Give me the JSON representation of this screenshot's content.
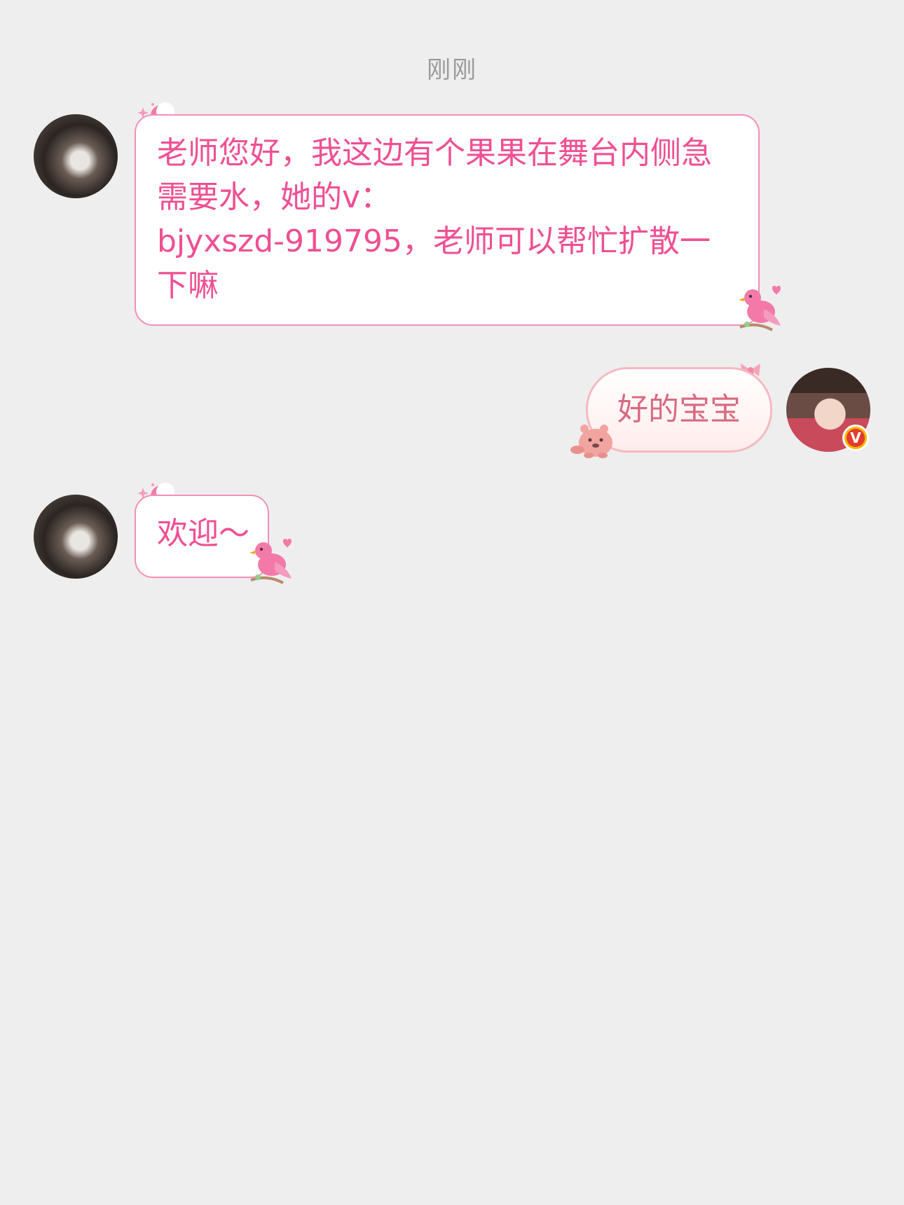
{
  "timestamp": "刚刚",
  "messages": [
    {
      "sender": "teacher",
      "text": "老师您好，我这边有个果果在舞台内侧急需要水，她的v：\nbjyxszd-919795，老师可以帮忙扩散一下嘛"
    },
    {
      "sender": "me",
      "text": "好的宝宝",
      "badge": "V"
    },
    {
      "sender": "teacher",
      "text": "欢迎～"
    }
  ],
  "colors": {
    "background": "#eeeeee",
    "incoming_text": "#ef4f93",
    "incoming_border": "#f28fb7",
    "outgoing_text": "#d96a82",
    "outgoing_border": "#f5b9c2",
    "timestamp": "#9b9b9b"
  }
}
